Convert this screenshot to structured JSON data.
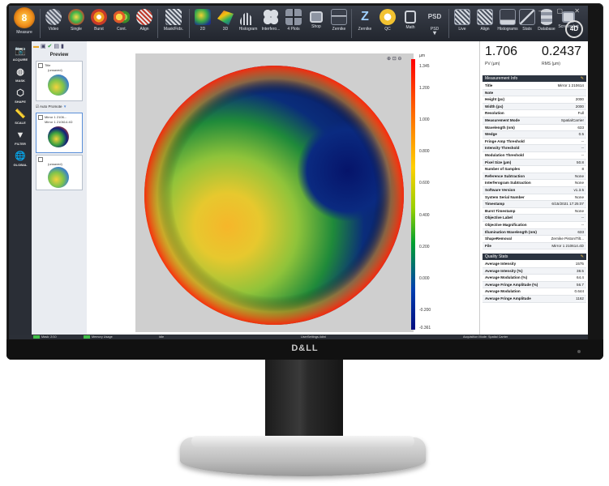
{
  "brand": {
    "monitor_logo": "D&LL",
    "app_logo": "4D"
  },
  "toolbar": {
    "items": [
      {
        "label": "Measure",
        "icon": "measure-icon"
      },
      {
        "label": "Video",
        "icon": "video-icon"
      },
      {
        "label": "Single",
        "icon": "single-icon"
      },
      {
        "label": "Burst",
        "icon": "burst-icon"
      },
      {
        "label": "Cont.",
        "icon": "continuous-icon"
      },
      {
        "label": "Align",
        "icon": "align-icon"
      },
      {
        "label": "Mask/Fids.",
        "icon": "mask-fiducials-icon"
      },
      {
        "label": "2D",
        "icon": "map-2d-icon"
      },
      {
        "label": "3D",
        "icon": "map-3d-icon"
      },
      {
        "label": "Histogram",
        "icon": "histogram-icon"
      },
      {
        "label": "Interfero...",
        "icon": "interferogram-icon"
      },
      {
        "label": "4 Plots",
        "icon": "four-plots-icon"
      },
      {
        "label": "Shop",
        "icon": "shop-icon"
      },
      {
        "label": "Zernike",
        "icon": "zernike-plot-icon"
      },
      {
        "label": "Zernike",
        "icon": "zernike-z-icon"
      },
      {
        "label": "QC",
        "icon": "qc-icon"
      },
      {
        "label": "Math",
        "icon": "math-icon"
      },
      {
        "label": "PSD",
        "icon": "psd-icon"
      },
      {
        "label": "Live",
        "icon": "live-icon"
      },
      {
        "label": "Align",
        "icon": "align-live-icon"
      },
      {
        "label": "Histograms",
        "icon": "histograms-icon"
      },
      {
        "label": "Stats",
        "icon": "stats-icon"
      },
      {
        "label": "Database",
        "icon": "database-icon"
      },
      {
        "label": "Screenshot",
        "icon": "screenshot-icon"
      }
    ],
    "window_controls": "— ▢ ✕"
  },
  "leftnav": [
    {
      "label": "ACQUIRE",
      "icon": "camera-icon"
    },
    {
      "label": "MASK",
      "icon": "mask-icon"
    },
    {
      "label": "SHAPE",
      "icon": "shape-icon"
    },
    {
      "label": "SCALE",
      "icon": "ruler-icon"
    },
    {
      "label": "FILTER",
      "icon": "funnel-icon"
    },
    {
      "label": "GLOBAL",
      "icon": "globe-icon"
    }
  ],
  "preview": {
    "title": "Preview",
    "auto_promote": "Auto Promote",
    "cards": [
      {
        "title": "Title",
        "sub": "(unsaved)"
      },
      {
        "title": "Mirror 1 2106...",
        "sub": "Mirror 1 210614.4D"
      },
      {
        "title": "",
        "sub": "(unsaved)"
      }
    ]
  },
  "colorbar": {
    "unit": "µm",
    "ticks": [
      "1.345",
      "1.200",
      "1.000",
      "0.800",
      "0.600",
      "0.400",
      "0.200",
      "0.000",
      "-0.200",
      "-0.361"
    ]
  },
  "metrics": {
    "pv": "1.706",
    "pv_label": "PV (µm)",
    "rms": "0.2437",
    "rms_label": "RMS (µm)"
  },
  "measurement_info": {
    "title": "Measurement Info",
    "rows": [
      {
        "k": "Title",
        "v": "Mirror 1 210614"
      },
      {
        "k": "Note",
        "v": ""
      },
      {
        "k": "Height (px)",
        "v": "2000"
      },
      {
        "k": "Width (px)",
        "v": "2000"
      },
      {
        "k": "Resolution",
        "v": "Full"
      },
      {
        "k": "Measurement Mode",
        "v": "SpatialCarrier"
      },
      {
        "k": "Wavelength (nm)",
        "v": "633"
      },
      {
        "k": "Wedge",
        "v": "0.5"
      },
      {
        "k": "Fringe Amp Threshold",
        "v": "--"
      },
      {
        "k": "Intensity Threshold",
        "v": "--"
      },
      {
        "k": "Modulation Threshold",
        "v": "--"
      },
      {
        "k": "Pixel Size (µm)",
        "v": "50.8"
      },
      {
        "k": "Number of Samples",
        "v": "8"
      },
      {
        "k": "Reference Subtraction",
        "v": "None"
      },
      {
        "k": "Interferogram Subtraction",
        "v": "None"
      },
      {
        "k": "Software Version",
        "v": "v1.3.5"
      },
      {
        "k": "System Serial Number",
        "v": "None"
      },
      {
        "k": "Timestamp",
        "v": "6/15/2021 17:25:07"
      },
      {
        "k": "Burst Timestamp",
        "v": "None"
      },
      {
        "k": "Objective Label",
        "v": "--"
      },
      {
        "k": "Objective Magnification",
        "v": "--"
      },
      {
        "k": "Illumination Wavelength (nm)",
        "v": "633"
      },
      {
        "k": "ShapeRemoval",
        "v": "Zernike Piston/Tilt..."
      },
      {
        "k": "File",
        "v": "Mirror 1 210614.4D"
      }
    ]
  },
  "quality_stats": {
    "title": "Quality Stats",
    "rows": [
      {
        "k": "Average Intensity",
        "v": "1575"
      },
      {
        "k": "Average Intensity (%)",
        "v": "38.5"
      },
      {
        "k": "Average Modulation (%)",
        "v": "64.4"
      },
      {
        "k": "Average Fringe Amplitude (%)",
        "v": "56.7"
      },
      {
        "k": "Average Modulation",
        "v": "0.644"
      },
      {
        "k": "Average Fringe Amplitude",
        "v": "1162"
      }
    ]
  },
  "status": {
    "mask": "Mask: 2/10",
    "memory": "Memory Usage",
    "state": "Idle",
    "settings": "UserSettings.4dini",
    "mode": "Acquisition Mode: Spatial Carrier"
  },
  "colors": {
    "bezel": "#151515",
    "toolbar": "#2a2e36",
    "accent": "#f3c34a"
  }
}
